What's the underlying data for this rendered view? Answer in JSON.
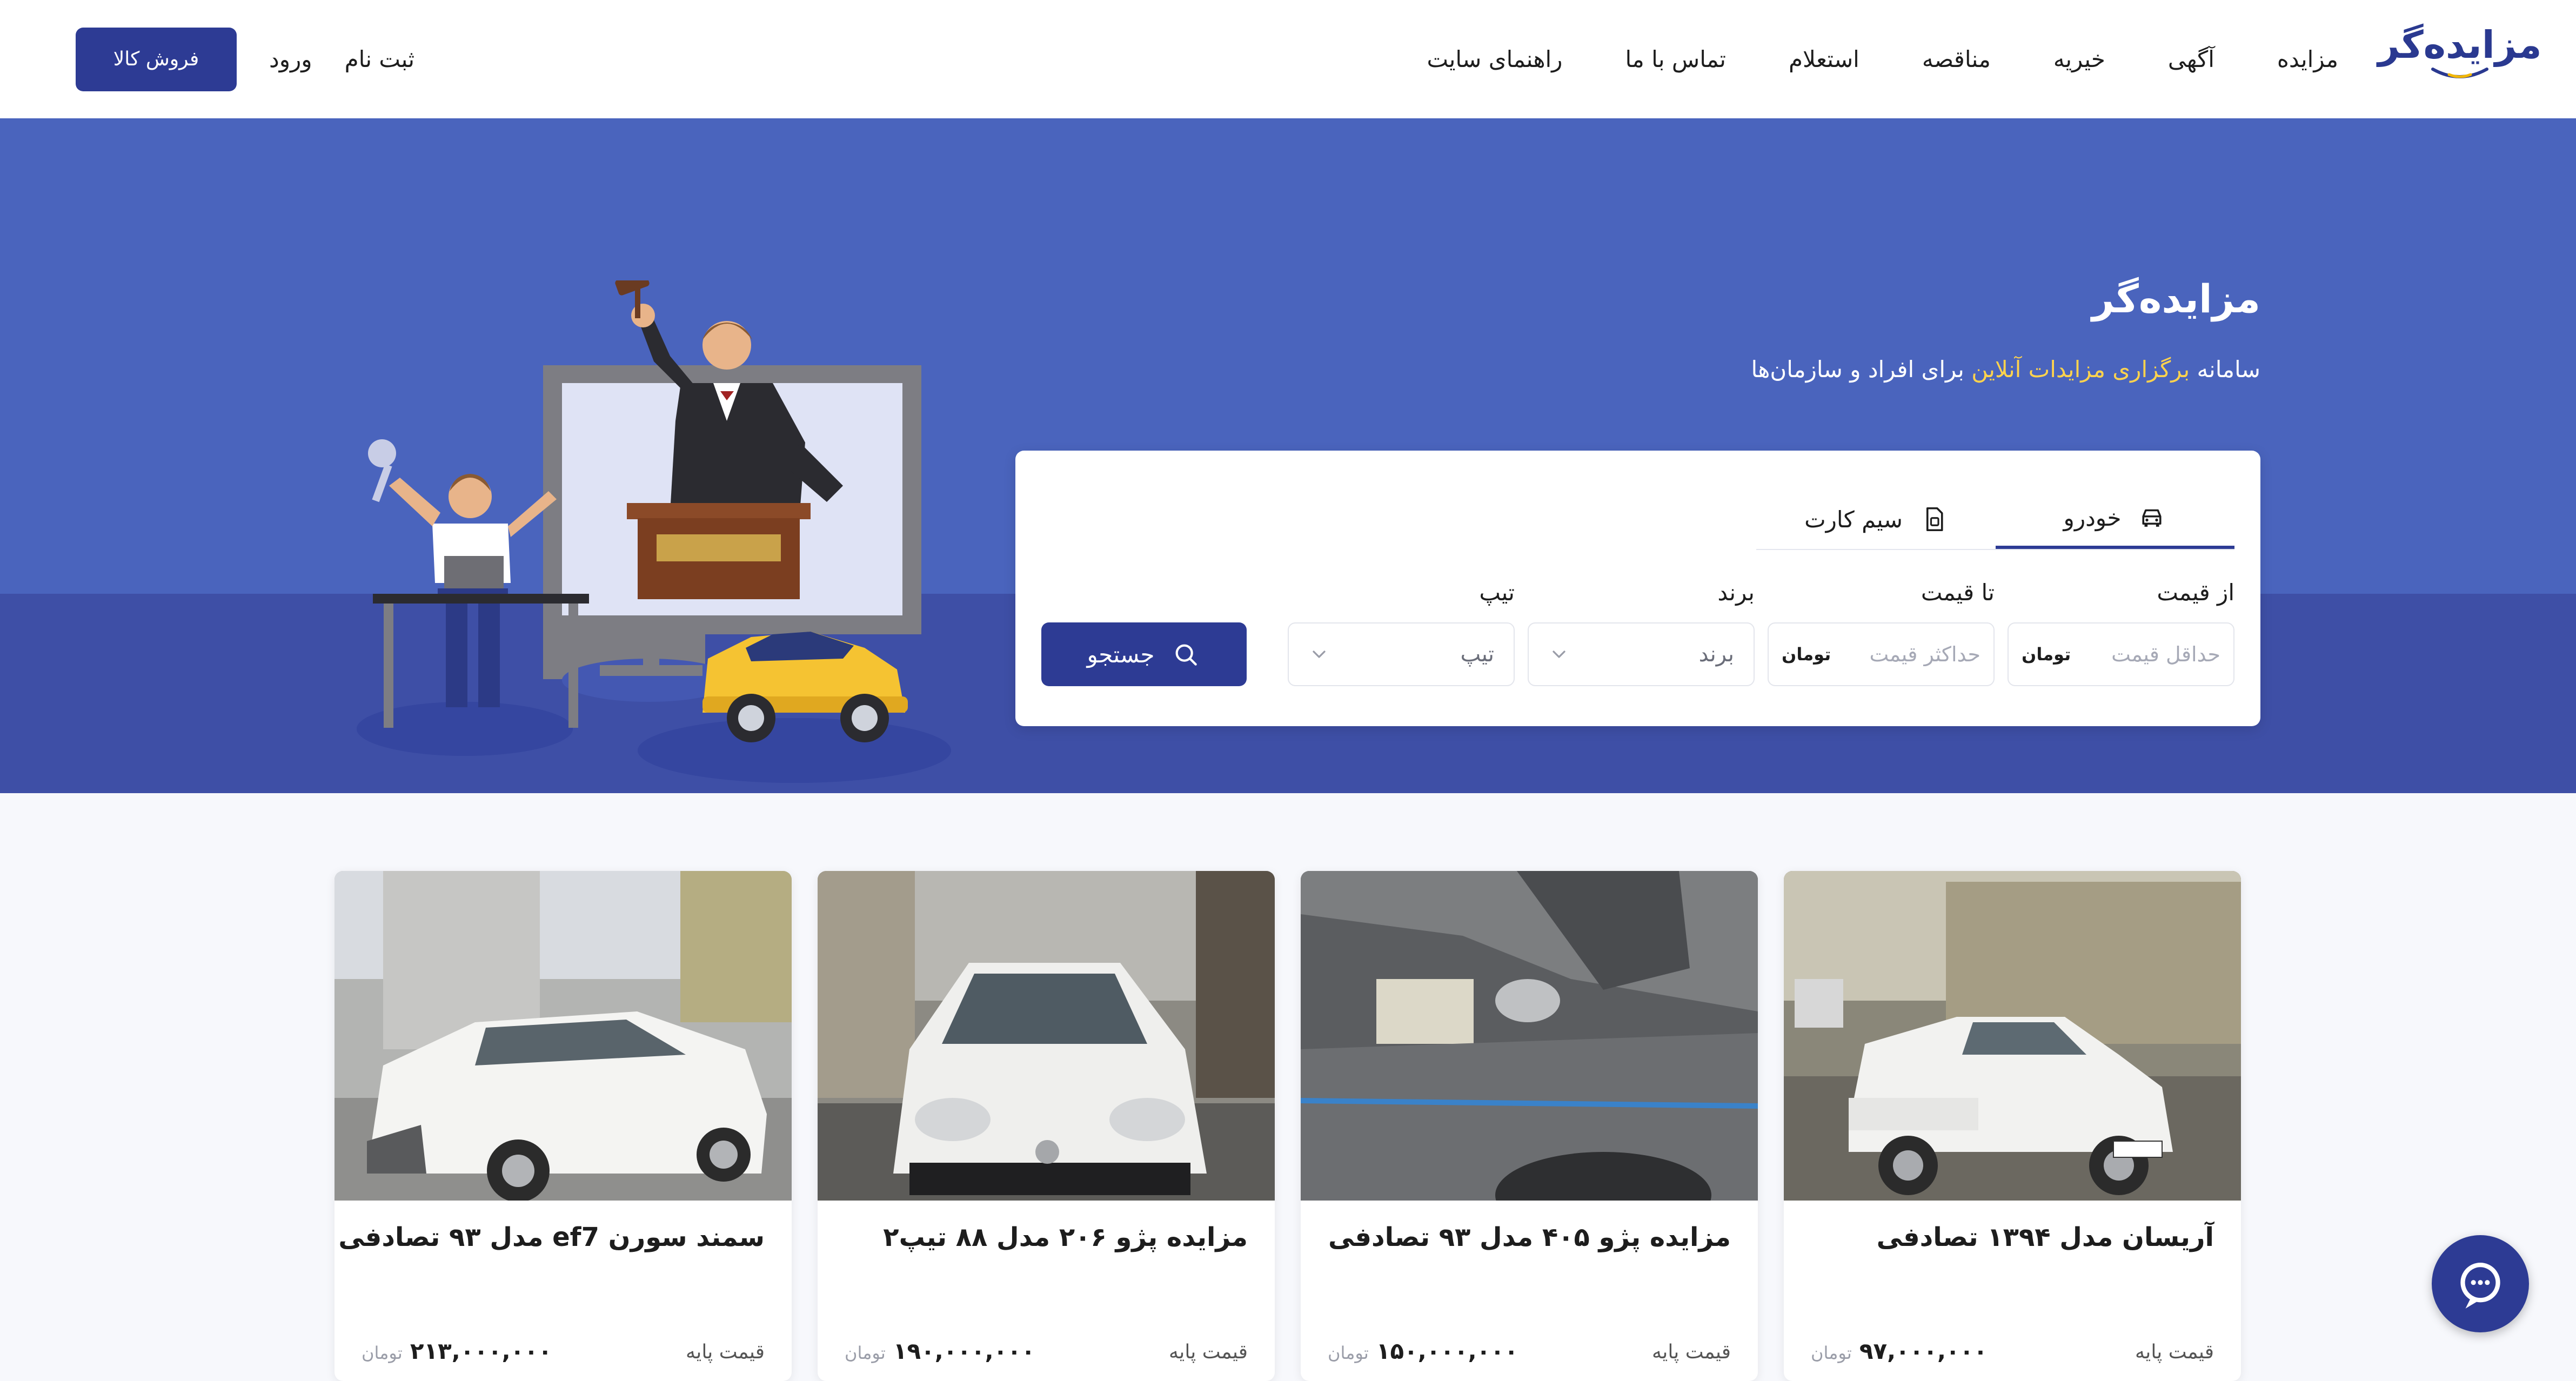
{
  "brand": {
    "logo_text": "مزایده‌گر"
  },
  "nav": {
    "items": [
      {
        "label": "مزایده"
      },
      {
        "label": "آگهی"
      },
      {
        "label": "خیریه"
      },
      {
        "label": "مناقصه"
      },
      {
        "label": "استعلام"
      },
      {
        "label": "تماس با ما"
      },
      {
        "label": "راهنمای سایت"
      }
    ],
    "login_label": "ورود",
    "register_label": "ثبت نام",
    "sell_button_label": "فروش کالا"
  },
  "hero": {
    "title": "مزایده‌گر",
    "subtitle_prefix": "سامانه ",
    "subtitle_highlight": "برگزاری مزایدات آنلاین",
    "subtitle_suffix": " برای افراد و سازمان‌ها"
  },
  "search": {
    "tabs": [
      {
        "label": "خودرو",
        "icon": "car-icon",
        "active": true
      },
      {
        "label": "سیم کارت",
        "icon": "sim-card-icon",
        "active": false
      }
    ],
    "from_price": {
      "label": "از قیمت",
      "placeholder": "حداقل قیمت",
      "unit": "تومان"
    },
    "to_price": {
      "label": "تا قیمت",
      "placeholder": "حداکثر قیمت",
      "unit": "تومان"
    },
    "brand": {
      "label": "برند",
      "value": "برند"
    },
    "type": {
      "label": "تیپ",
      "value": "تیپ"
    },
    "submit_label": "جستجو"
  },
  "listings": [
    {
      "title": "آریسان مدل ۱۳۹۴ تصادفی",
      "price_label": "قیمت پایه",
      "price": "۹۷,۰۰۰,۰۰۰",
      "unit": "تومان"
    },
    {
      "title": "مزایده پژو ۴۰۵ مدل ۹۳ تصادفی",
      "price_label": "قیمت پایه",
      "price": "۱۵۰,۰۰۰,۰۰۰",
      "unit": "تومان"
    },
    {
      "title": "مزایده پژو ۲۰۶ مدل ۸۸ تیپ۲",
      "price_label": "قیمت پایه",
      "price": "۱۹۰,۰۰۰,۰۰۰",
      "unit": "تومان"
    },
    {
      "title": "سمند سورن ef7 مدل ۹۳ تصادفی",
      "price_label": "قیمت پایه",
      "price": "۲۱۳,۰۰۰,۰۰۰",
      "unit": "تومان"
    }
  ],
  "colors": {
    "primary": "#2d3b94",
    "hero_bg": "#4a64bd",
    "hero_band": "#3e4fa6",
    "highlight": "#ffd34d"
  },
  "chat": {
    "icon": "chat-icon"
  }
}
